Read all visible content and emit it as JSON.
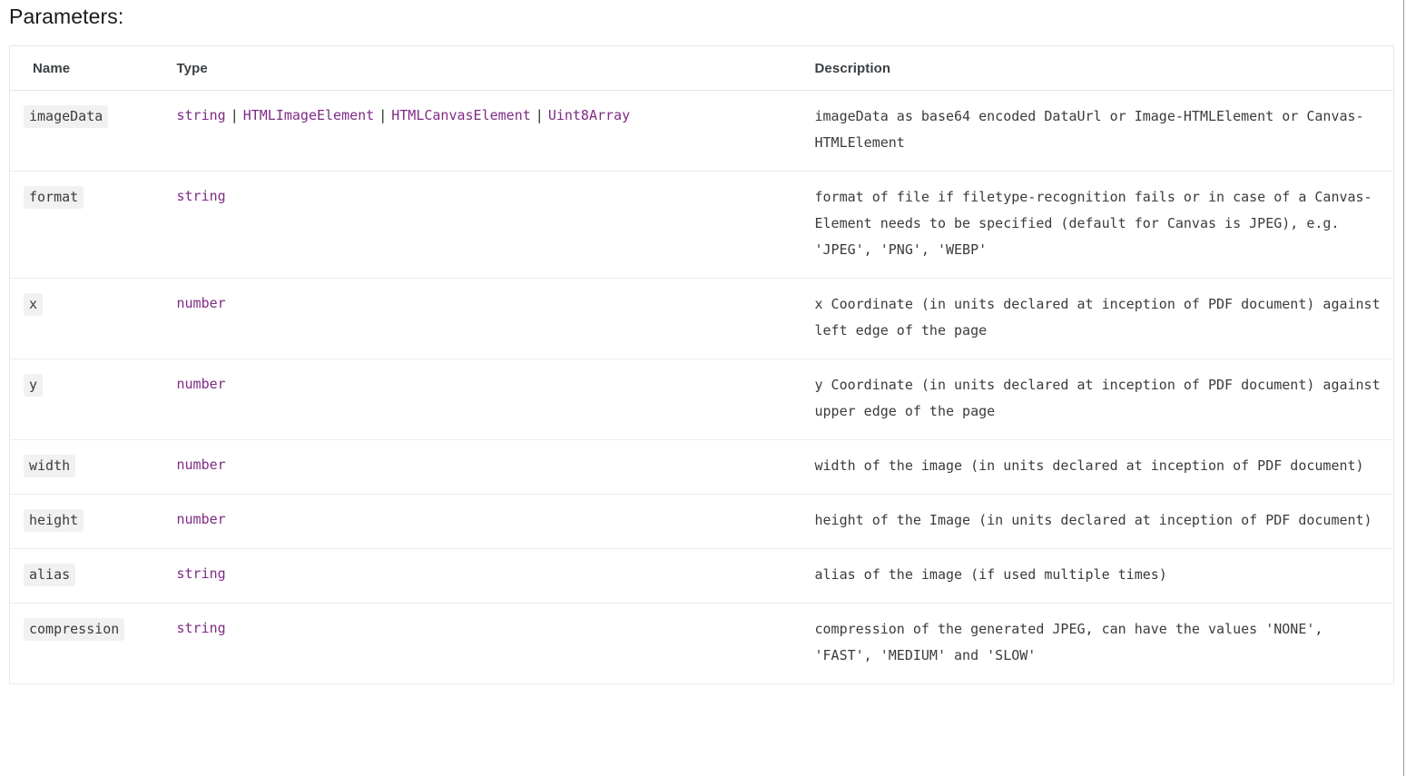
{
  "heading": "Parameters:",
  "table": {
    "columns": [
      {
        "key": "name",
        "label": "Name"
      },
      {
        "key": "type",
        "label": "Type"
      },
      {
        "key": "description",
        "label": "Description"
      }
    ],
    "separator": "|",
    "accent_type_color": "#7f2a86",
    "code_chip_bg": "#f1f1f1",
    "row_border_color": "#ededed",
    "rows": [
      {
        "name": "imageData",
        "types": [
          "string",
          "HTMLImageElement",
          "HTMLCanvasElement",
          "Uint8Array"
        ],
        "description": "imageData as base64 encoded DataUrl or Image-HTMLElement or Canvas-HTMLElement"
      },
      {
        "name": "format",
        "types": [
          "string"
        ],
        "description": "format of file if filetype-recognition fails or in case of a Canvas-Element needs to be specified (default for Canvas is JPEG), e.g. 'JPEG', 'PNG', 'WEBP'"
      },
      {
        "name": "x",
        "types": [
          "number"
        ],
        "description": "x Coordinate (in units declared at inception of PDF document) against left edge of the page"
      },
      {
        "name": "y",
        "types": [
          "number"
        ],
        "description": "y Coordinate (in units declared at inception of PDF document) against upper edge of the page"
      },
      {
        "name": "width",
        "types": [
          "number"
        ],
        "description": "width of the image (in units declared at inception of PDF document)"
      },
      {
        "name": "height",
        "types": [
          "number"
        ],
        "description": "height of the Image (in units declared at inception of PDF document)"
      },
      {
        "name": "alias",
        "types": [
          "string"
        ],
        "description": "alias of the image (if used multiple times)"
      },
      {
        "name": "compression",
        "types": [
          "string"
        ],
        "description": "compression of the generated JPEG, can have the values 'NONE', 'FAST', 'MEDIUM' and 'SLOW'"
      }
    ]
  }
}
